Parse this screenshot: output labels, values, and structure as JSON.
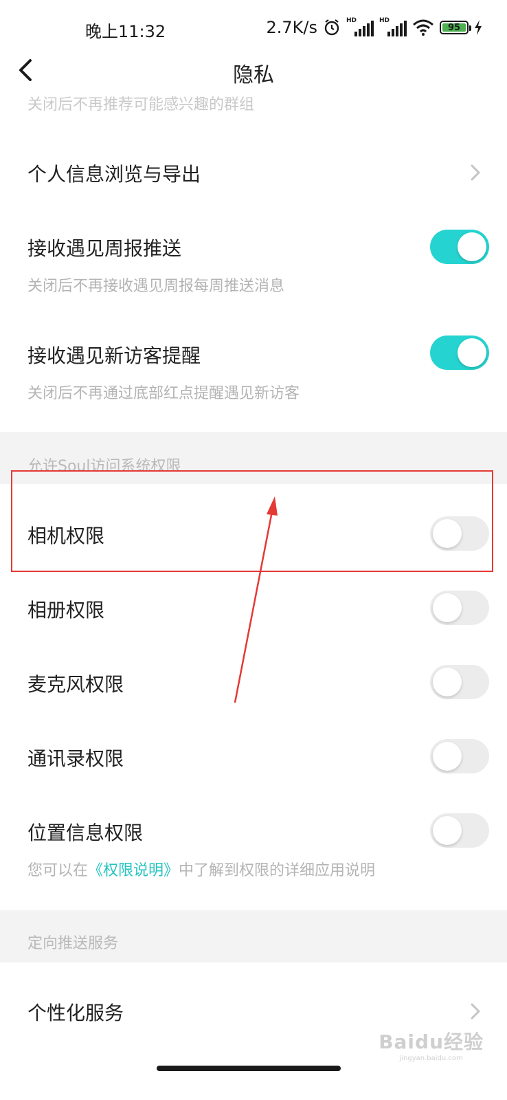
{
  "status_bar": {
    "time": "晚上11:32",
    "network_speed": "2.7K/s",
    "hd_label": "HD",
    "battery_level": "95",
    "icons": [
      "alarm-icon",
      "signal-icon",
      "signal-icon",
      "wifi-icon",
      "battery-icon",
      "charging-icon"
    ]
  },
  "nav": {
    "title": "隐私",
    "back_icon": "chevron-left-icon"
  },
  "cut_off_text": "关闭后不再推荐可能感兴趣的群组",
  "settings": {
    "personal_info": {
      "label": "个人信息浏览与导出",
      "icon": "chevron-right-icon"
    },
    "weekly_push": {
      "label": "接收遇见周报推送",
      "desc": "关闭后不再接收遇见周报每周推送消息",
      "enabled": true
    },
    "new_visitor": {
      "label": "接收遇见新访客提醒",
      "desc": "关闭后不再通过底部红点提醒遇见新访客",
      "enabled": true
    }
  },
  "permissions": {
    "section_title": "允许Soul访问系统权限",
    "items": [
      {
        "label": "相机权限",
        "enabled": false
      },
      {
        "label": "相册权限",
        "enabled": false
      },
      {
        "label": "麦克风权限",
        "enabled": false
      },
      {
        "label": "通讯录权限",
        "enabled": false
      },
      {
        "label": "位置信息权限",
        "enabled": false
      }
    ],
    "note_prefix": "您可以在",
    "note_link": "《权限说明》",
    "note_suffix": "中了解到权限的详细应用说明"
  },
  "targeted_push": {
    "section_title": "定向推送服务",
    "personalized": {
      "label": "个性化服务",
      "icon": "chevron-right-icon"
    }
  },
  "watermark": {
    "text": "Baidu经验",
    "sub": "jingyan.baidu.com"
  },
  "colors": {
    "toggle_on": "#25d4d0",
    "toggle_off": "#ececec",
    "annotation_red": "#e53935",
    "link": "#25c4c0",
    "section_bg": "#f3f3f3"
  }
}
